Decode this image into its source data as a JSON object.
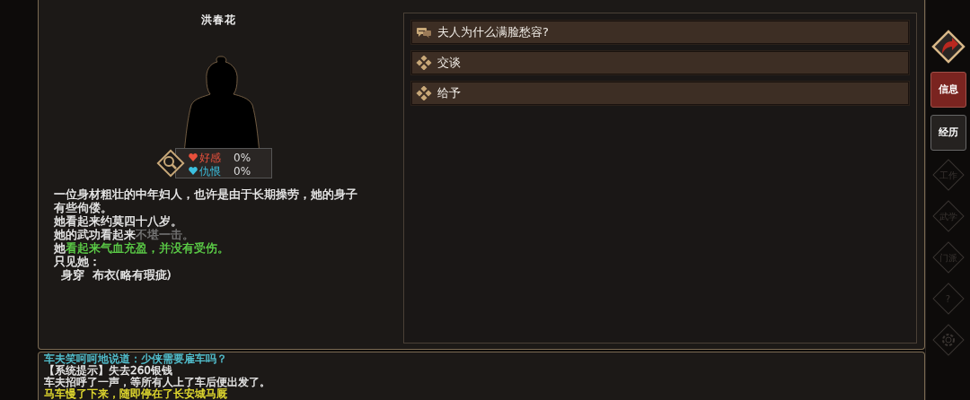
{
  "character": {
    "name": "洪春花",
    "relations": [
      {
        "label": "好感",
        "value": "0%",
        "color": "#e8503c"
      },
      {
        "label": "仇恨",
        "value": "0%",
        "color": "#3cc0e0"
      }
    ],
    "description": [
      [
        {
          "text": "一位身材粗壮的中年妇人，也许是由于长期操劳，她的身子有些佝偻。",
          "color": "#eeeeee"
        }
      ],
      [
        {
          "text": "她看起来约莫四十八岁。",
          "color": "#eeeeee"
        }
      ],
      [
        {
          "text": "她的武功看起来",
          "color": "#eeeeee"
        },
        {
          "text": "不堪一击。",
          "color": "#777777"
        }
      ],
      [
        {
          "text": "她",
          "color": "#eeeeee"
        },
        {
          "text": "看起来气血充盈，并没有受伤。",
          "color": "#5fd64a"
        }
      ],
      [
        {
          "text": "只见她：",
          "color": "#eeeeee"
        }
      ],
      [
        {
          "text": "  身穿  布衣(略有瑕疵)",
          "color": "#eeeeee"
        }
      ]
    ]
  },
  "options": [
    {
      "kind": "question",
      "label": "夫人为什么满脸愁容?"
    },
    {
      "kind": "action",
      "label": "交谈"
    },
    {
      "kind": "action",
      "label": "给予"
    }
  ],
  "side_tabs": [
    {
      "kind": "back"
    },
    {
      "kind": "tab",
      "label": "信息",
      "selected": true,
      "disabled": false
    },
    {
      "kind": "tab",
      "label": "经历",
      "selected": false,
      "disabled": false
    },
    {
      "kind": "diamond",
      "label": "工作",
      "selected": false,
      "disabled": true
    },
    {
      "kind": "diamond",
      "label": "武学",
      "selected": false,
      "disabled": true
    },
    {
      "kind": "diamond",
      "label": "门派",
      "selected": false,
      "disabled": true
    },
    {
      "kind": "diamond",
      "label": "?",
      "selected": false,
      "disabled": true
    },
    {
      "kind": "gear",
      "selected": false,
      "disabled": true
    }
  ],
  "log": [
    {
      "text": "车夫笑呵呵地说道：少侠需要雇车吗？",
      "color": "#55c8d8"
    },
    {
      "text": "【系统提示】失去260银钱",
      "color": "#eeeeee"
    },
    {
      "text": "车夫招呼了一声，等所有人上了车后便出发了。",
      "color": "#eeeeee"
    },
    {
      "text": "马车慢了下来，随即停在了长安城马厩",
      "color": "#e8e030"
    }
  ]
}
